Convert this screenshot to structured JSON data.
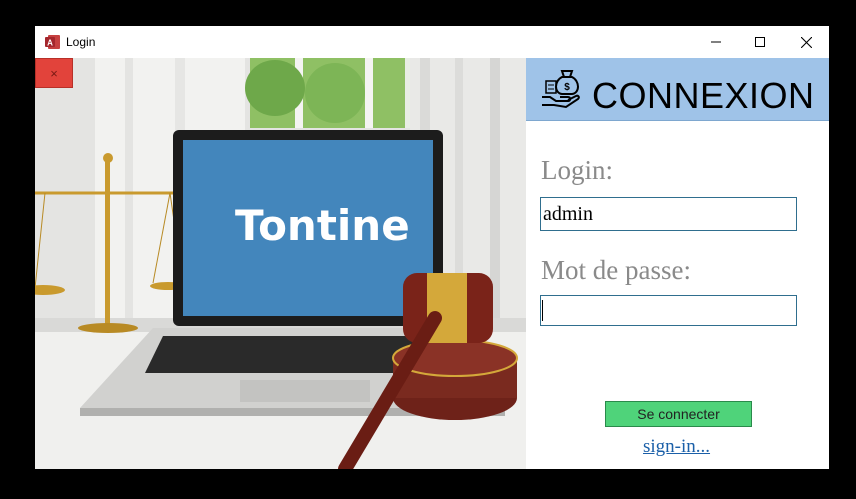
{
  "window": {
    "title": "Login",
    "app_icon": "access-app-icon",
    "controls": {
      "minimize_icon": "minimize-icon",
      "maximize_icon": "maximize-icon",
      "close_icon": "close-icon"
    }
  },
  "photo": {
    "screen_text": "Tontine",
    "close_button_label": "×"
  },
  "header": {
    "icon": "money-bag-hand-icon",
    "title": "CONNEXION"
  },
  "form": {
    "login_label": "Login:",
    "login_value": "admin",
    "password_label": "Mot de passe:",
    "password_value": "",
    "submit_label": "Se connecter",
    "signin_link": "sign-in..."
  },
  "colors": {
    "header_bg": "#9fc3e8",
    "button_bg": "#4fd37a",
    "close_button_bg": "#e2433b",
    "link": "#1a5fa8",
    "label": "#8a8a8a"
  }
}
